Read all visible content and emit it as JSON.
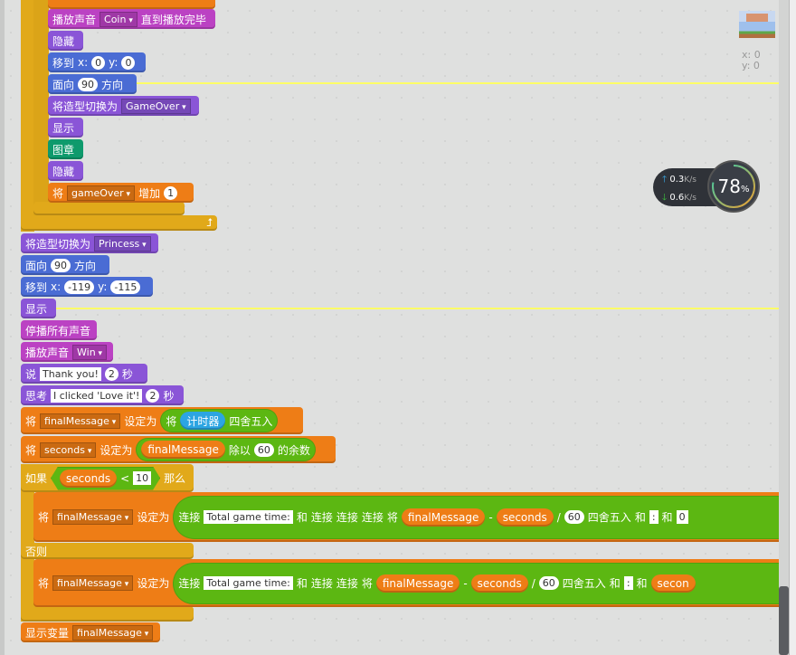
{
  "script": {
    "coin": {
      "a": "播放声音",
      "v": "Coin",
      "b": "直到播放完毕"
    },
    "hide": "隐藏",
    "goto1": {
      "a": "移到",
      "x": "x:",
      "xv": "0",
      "y": "y:",
      "yv": "0"
    },
    "point1": {
      "a": "面向",
      "v": "90",
      "b": "方向"
    },
    "costume1": {
      "a": "将造型切换为",
      "v": "GameOver"
    },
    "show": "显示",
    "stamp": "图章",
    "change": {
      "a": "将",
      "v": "gameOver",
      "b": "增加",
      "n": "1"
    },
    "costume2": {
      "a": "将造型切换为",
      "v": "Princess"
    },
    "point2": {
      "a": "面向",
      "v": "90",
      "b": "方向"
    },
    "goto2": {
      "a": "移到",
      "x": "x:",
      "xv": "-119",
      "y": "y:",
      "yv": "-115"
    },
    "stopsounds": "停播所有声音",
    "playwin": {
      "a": "播放声音",
      "v": "Win"
    },
    "say": {
      "a": "说",
      "t": "Thank you!",
      "n": "2",
      "b": "秒"
    },
    "think": {
      "a": "思考",
      "t": "I clicked 'Love it'!",
      "n": "2",
      "b": "秒"
    },
    "set1": {
      "a": "将",
      "v": "finalMessage",
      "b": "设定为",
      "r1": "将",
      "r2": "计时器",
      "r3": "四舍五入"
    },
    "set2": {
      "a": "将",
      "v": "seconds",
      "b": "设定为",
      "r1": "finalMessage",
      "r2": "除以",
      "r3": "60",
      "r4": "的余数"
    },
    "if": {
      "a": "如果",
      "v": "seconds",
      "op": "<",
      "n": "10",
      "b": "那么",
      "else": "否则"
    },
    "set3": {
      "a": "将",
      "v": "finalMessage",
      "b": "设定为",
      "j": "连接",
      "t": "Total game time:",
      "and": "和",
      "r": "将",
      "m": "finalMessage",
      "minus": "-",
      "s": "seconds",
      "div": "/",
      "n": "60",
      "round": "四舍五入",
      "colon": ":",
      "zero": "0"
    },
    "set4": {
      "a": "将",
      "v": "finalMessage",
      "b": "设定为",
      "j": "连接",
      "t": "Total game time:",
      "and": "和",
      "r": "将",
      "m": "finalMessage",
      "minus": "-",
      "s": "seconds",
      "div": "/",
      "n": "60",
      "round": "四舍五入",
      "colon": ":",
      "s2": "secon"
    },
    "showvar": {
      "a": "显示变量",
      "v": "finalMessage"
    }
  },
  "stage": {
    "x": "x: 0",
    "y": "y: 0"
  },
  "net": {
    "up": "0.3",
    "down": "0.6",
    "unit": "K/s",
    "pct": "78",
    "pct_sign": "%",
    "up_color": "#3ab0f0",
    "down_color": "#3cc13c"
  },
  "colors": {
    "looks": "#8a55d7",
    "sound": "#bb42c3",
    "motion": "#4a6cd4",
    "pen": "#0e9a6c",
    "data": "#ee7d16",
    "control": "#e1a91a",
    "operators": "#5cb712",
    "sensing": "#2ca5e2"
  }
}
